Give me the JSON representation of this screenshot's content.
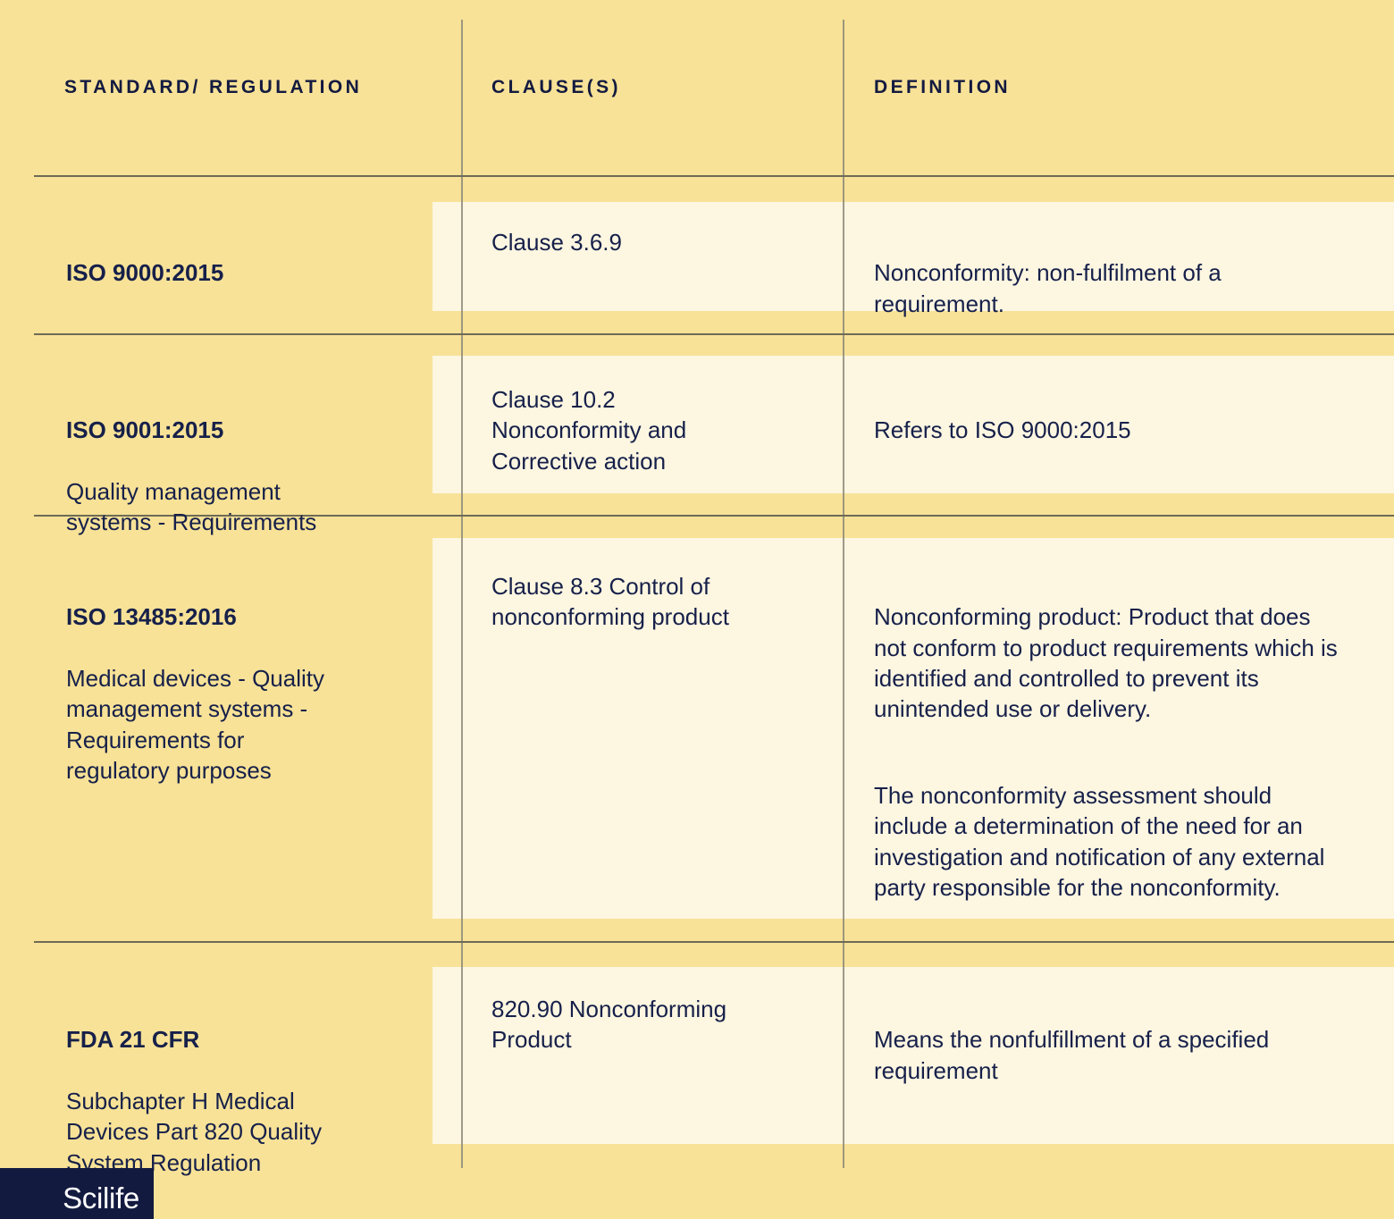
{
  "table": {
    "headers": [
      {
        "label": "STANDARD/\nREGULATION"
      },
      {
        "label": "CLAUSE(S)"
      },
      {
        "label": "DEFINITION"
      }
    ],
    "rows": [
      {
        "standard_title": "ISO 9000:2015",
        "standard_detail": "",
        "clause": "Clause 3.6.9",
        "definition_paragraphs": [
          {
            "text": "Nonconformity: non-fulfilment of a requirement.",
            "italic": false
          }
        ]
      },
      {
        "standard_title": "ISO 9001:2015",
        "standard_detail": "Quality management\nsystems - Requirements",
        "clause": "Clause 10.2\nNonconformity and\nCorrective action",
        "definition_paragraphs": [
          {
            "text": "Refers to ISO 9000:2015",
            "italic": false
          }
        ]
      },
      {
        "standard_title": "ISO 13485:2016",
        "standard_detail": "Medical devices - Quality\nmanagement systems -\nRequirements for\nregulatory purposes",
        "clause": "Clause 8.3 Control of\nnonconforming product",
        "definition_paragraphs": [
          {
            "text": "Nonconforming product: Product that does not conform to product requirements which is identified and controlled to prevent its unintended use or delivery.",
            "italic": true
          },
          {
            "text": "The nonconformity assessment should include a determination of the need for an investigation and notification of any external party responsible for the nonconformity.",
            "italic": false
          }
        ]
      },
      {
        "standard_title": "FDA 21 CFR",
        "standard_detail": "Subchapter H Medical\nDevices Part 820 Quality\nSystem Regulation",
        "clause": "820.90 Nonconforming\nProduct",
        "definition_paragraphs": [
          {
            "text": "Means the nonfulfillment of a specified requirement",
            "italic": false
          }
        ]
      }
    ]
  },
  "branding": {
    "logo_text": "Scilife"
  },
  "colors": {
    "background": "#F8E297",
    "cell_highlight": "#FDF6E1",
    "text": "#131A40",
    "rule": "#6E6A55",
    "logo_background": "#131A40",
    "logo_text": "#FFFFFF"
  }
}
